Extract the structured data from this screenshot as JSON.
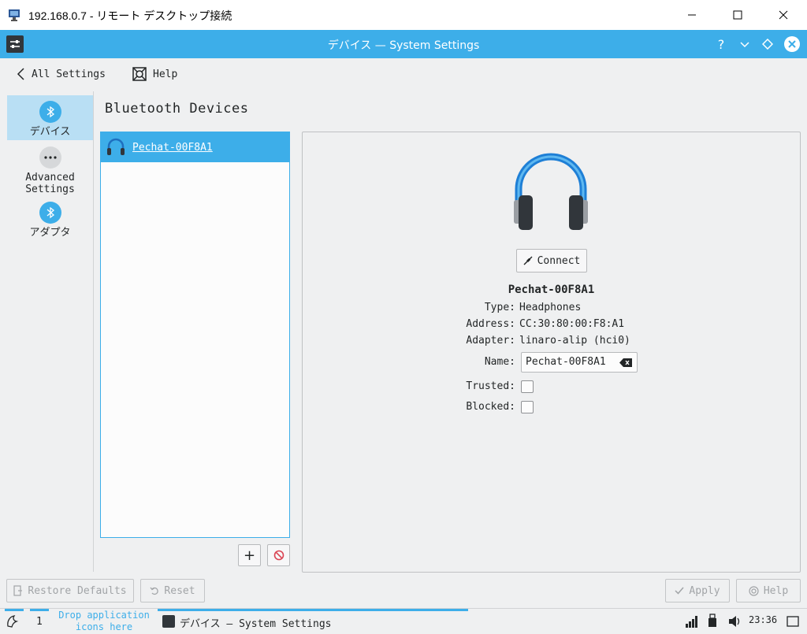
{
  "rdp": {
    "title": "192.168.0.7 - リモート デスクトップ接続",
    "minimize_icon": "minimize-icon",
    "maximize_icon": "maximize-icon",
    "close_icon": "close-icon"
  },
  "window": {
    "title": "デバイス — System Settings",
    "buttons": [
      "help-icon",
      "minimize-icon",
      "keep-above-icon",
      "close-icon"
    ]
  },
  "toolbar": {
    "all_settings": "All Settings",
    "help": "Help"
  },
  "sidebar": {
    "items": [
      {
        "label": "デバイス",
        "icon": "bluetooth-icon",
        "selected": true
      },
      {
        "label": "Advanced\nSettings",
        "label_line1": "Advanced",
        "label_line2": "Settings",
        "icon": "more-icon",
        "selected": false
      },
      {
        "label": "アダプタ",
        "icon": "bluetooth-icon",
        "selected": false
      }
    ]
  },
  "page": {
    "heading": "Bluetooth Devices"
  },
  "devices": [
    {
      "name": "Pechat-00F8A1",
      "icon": "headphones-icon",
      "selected": true
    }
  ],
  "list_actions": {
    "add": "+",
    "remove_icon": "remove-icon"
  },
  "details": {
    "connect_label": "Connect",
    "device_name": "Pechat-00F8A1",
    "type_label": "Type:",
    "type_value": "Headphones",
    "address_label": "Address:",
    "address_value": "CC:30:80:00:F8:A1",
    "adapter_label": "Adapter:",
    "adapter_value": "linaro-alip (hci0)",
    "name_label": "Name:",
    "name_value": "Pechat-00F8A1",
    "trusted_label": "Trusted:",
    "trusted_checked": false,
    "blocked_label": "Blocked:",
    "blocked_checked": false
  },
  "bottom_buttons": {
    "restore_defaults": "Restore Defaults",
    "reset": "Reset",
    "apply": "Apply",
    "help": "Help"
  },
  "taskbar": {
    "desktop_number": "1",
    "drop_line1": "Drop application",
    "drop_line2": "icons here",
    "task_title": "デバイス  — System Settings",
    "clock": "23:36"
  },
  "colors": {
    "accent": "#3daee9",
    "selection_light": "#b9dff4",
    "background": "#eff0f1",
    "text": "#232627"
  }
}
